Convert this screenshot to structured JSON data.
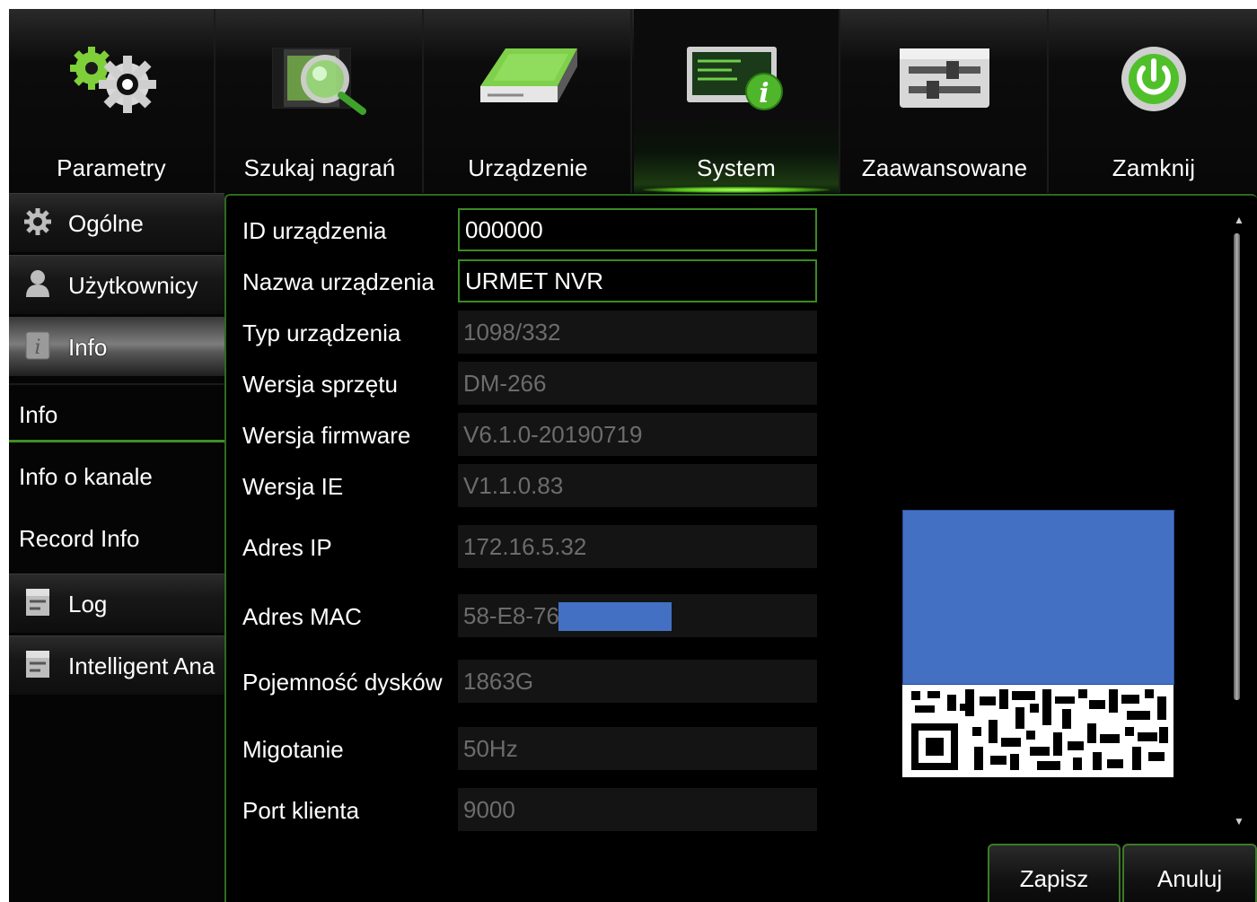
{
  "nav": {
    "tabs": [
      {
        "label": "Parametry",
        "icon": "gears-icon"
      },
      {
        "label": "Szukaj nagrań",
        "icon": "film-search-icon"
      },
      {
        "label": "Urządzenie",
        "icon": "hard-drive-icon"
      },
      {
        "label": "System",
        "icon": "system-info-icon",
        "active": true
      },
      {
        "label": "Zaawansowane",
        "icon": "sliders-icon"
      },
      {
        "label": "Zamknij",
        "icon": "power-icon"
      }
    ]
  },
  "sidebar": {
    "groups": [
      {
        "label": "Ogólne",
        "icon": "gear-icon"
      },
      {
        "label": "Użytkownicy",
        "icon": "user-icon"
      },
      {
        "label": "Info",
        "icon": "info-icon",
        "selected": true
      },
      {
        "label": "Log",
        "icon": "log-icon"
      },
      {
        "label": "Intelligent Ana",
        "icon": "analytics-icon"
      }
    ],
    "subitems": [
      {
        "label": "Info",
        "current": true
      },
      {
        "label": "Info o kanale"
      },
      {
        "label": "Record Info"
      }
    ]
  },
  "info": {
    "rows": [
      {
        "label": "ID urządzenia",
        "value": "000000",
        "editable": true
      },
      {
        "label": "Nazwa urządzenia",
        "value": "URMET NVR",
        "editable": true
      },
      {
        "label": "Typ urządzenia",
        "value": "1098/332"
      },
      {
        "label": "Wersja sprzętu",
        "value": "DM-266"
      },
      {
        "label": "Wersja firmware",
        "value": "V6.1.0-20190719"
      },
      {
        "label": "Wersja IE",
        "value": "V1.1.0.83"
      },
      {
        "label": "Adres IP",
        "value": "172.16.5.32"
      },
      {
        "label": "Adres MAC",
        "value": "58-E8-76"
      },
      {
        "label": "Pojemność dysków",
        "value": "1863G"
      },
      {
        "label": "Migotanie",
        "value": "50Hz"
      },
      {
        "label": "Port klienta",
        "value": "9000"
      }
    ]
  },
  "buttons": {
    "save": "Zapisz",
    "cancel": "Anuluj"
  },
  "colors": {
    "accent": "#3d8f26",
    "redaction": "#4470c4"
  }
}
